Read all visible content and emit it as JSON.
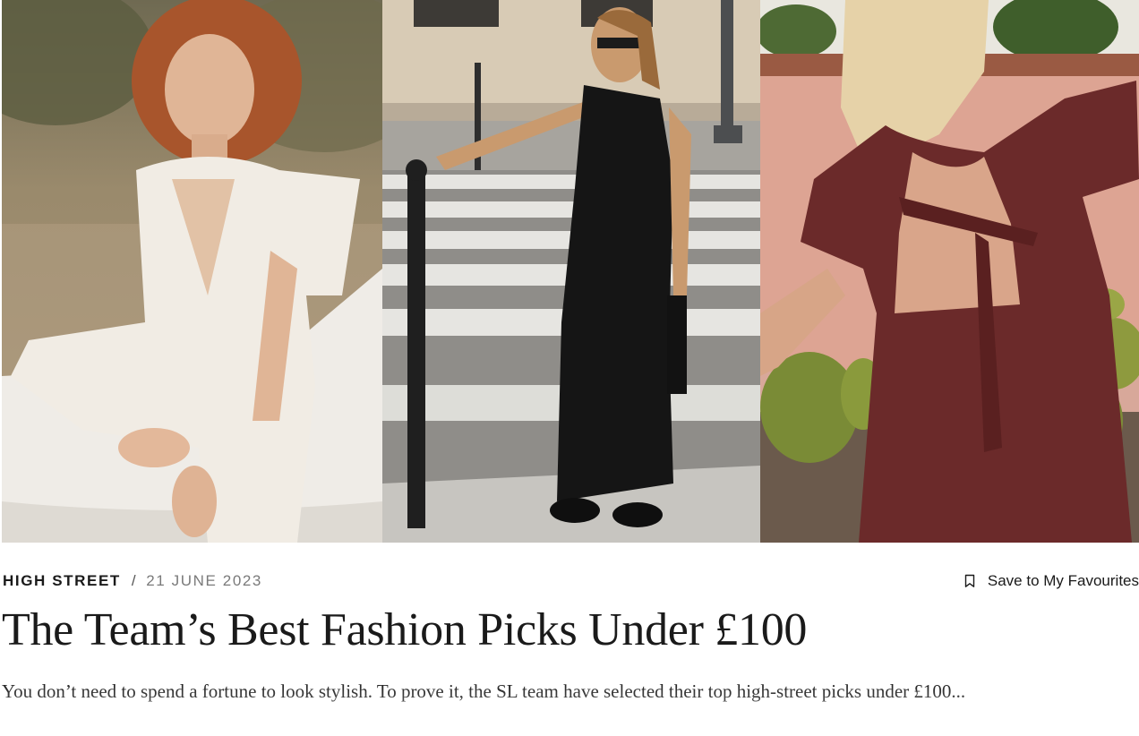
{
  "hero": {
    "images": [
      {
        "name": "woman-in-white-jumpsuit-photo"
      },
      {
        "name": "woman-in-black-dress-photo"
      },
      {
        "name": "woman-in-burgundy-dress-photo"
      }
    ]
  },
  "article": {
    "category": "HIGH STREET",
    "separator": "/",
    "date": "21 JUNE 2023",
    "save_label": "Save to My Favourites",
    "title": "The Team’s Best Fashion Picks Under £100",
    "excerpt": "You don’t need to spend a fortune to look stylish. To prove it, the SL team have selected their top high-street picks under £100..."
  },
  "icons": {
    "save": "bookmark-icon"
  },
  "colors": {
    "text": "#1a1a1a",
    "date": "#7a7a7a",
    "background": "#ffffff"
  }
}
